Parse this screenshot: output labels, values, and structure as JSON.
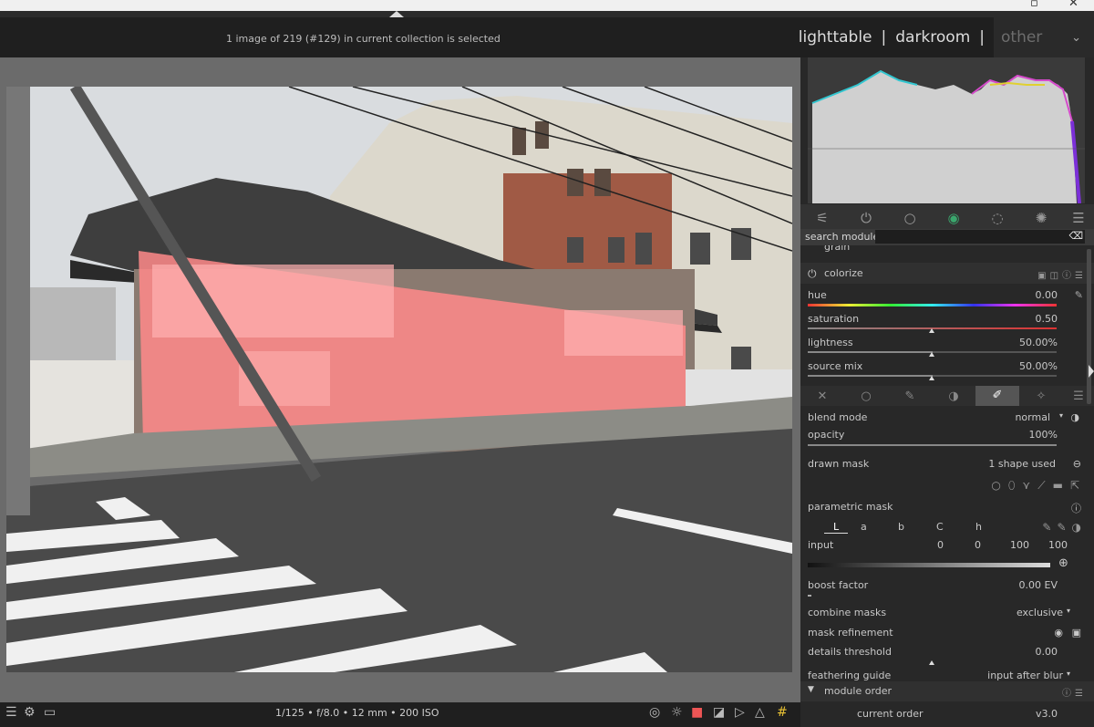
{
  "header": {
    "status": "1 image of 219 (#129) in current collection is selected",
    "views": [
      "lighttable",
      "darkroom",
      "other"
    ],
    "separator": "|"
  },
  "footer": {
    "exif": "1/125 • f/8.0 • 12 mm • 200 ISO"
  },
  "right_panel": {
    "search_label": "search module",
    "search_value": "",
    "grain_label": "grain",
    "colorize": {
      "title": "colorize",
      "sliders": [
        {
          "label": "hue",
          "value": "0.00",
          "level": 0.0
        },
        {
          "label": "saturation",
          "value": "0.50",
          "level": 0.5
        },
        {
          "label": "lightness",
          "value": "50.00%",
          "level": 0.5
        },
        {
          "label": "source mix",
          "value": "50.00%",
          "level": 0.5
        }
      ]
    },
    "blend": {
      "blend_mode_label": "blend mode",
      "blend_mode_value": "normal",
      "opacity_label": "opacity",
      "opacity_value": "100%",
      "opacity_level": 1.0,
      "drawn_mask_label": "drawn mask",
      "drawn_mask_value": "1 shape used",
      "parametric_mask_label": "parametric mask",
      "channels": [
        "L",
        "a",
        "b",
        "C",
        "h"
      ],
      "input_label": "input",
      "input_values": [
        "0",
        "0",
        "100",
        "100"
      ],
      "boost_label": "boost factor",
      "boost_value": "0.00 EV",
      "combine_label": "combine masks",
      "combine_value": "exclusive",
      "refinement_label": "mask refinement",
      "details_label": "details threshold",
      "details_value": "0.00",
      "details_level": 0.5,
      "feathering_label": "feathering guide",
      "feathering_value": "input after blur"
    },
    "module_order": {
      "title": "module order",
      "current_label": "current order",
      "current_value": "v3.0"
    }
  },
  "colors": {
    "accent_mask": "#ff6b6b",
    "panel_bg": "#282828"
  }
}
